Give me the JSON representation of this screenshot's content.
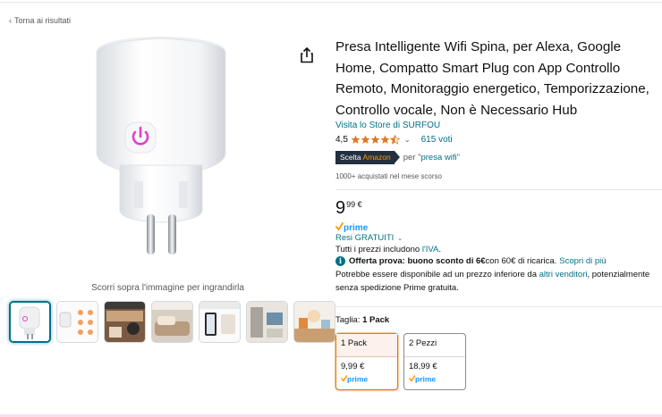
{
  "nav": {
    "back_label": "Torna ai risultati"
  },
  "gallery": {
    "zoom_hint": "Scorri sopra l'immagine per ingrandirla",
    "thumbnails": [
      "thumb-1",
      "thumb-2",
      "thumb-3",
      "thumb-4",
      "thumb-5",
      "thumb-6",
      "thumb-7"
    ]
  },
  "product": {
    "title": "Presa Intelligente Wifi Spina, per Alexa, Google Home, Compatto Smart Plug con App Controllo Remoto, Monitoraggio energetico, Temporizzazione, Controllo vocale, Non è Necessario Hub",
    "store_link": "Visita lo Store di SURFOU",
    "rating_value": "4,5",
    "rating_count": "615 voti",
    "choice_badge_prefix": "Scelta ",
    "choice_badge_brand": "Amazon",
    "choice_for_prefix": "per \"",
    "choice_for_keyword": "presa wifi",
    "choice_for_suffix": "\"",
    "bought_text": "1000+ acquistati nel mese scorso",
    "price_whole": "9",
    "price_fraction": "99 €",
    "prime_label": "prime",
    "returns_label": "Resi GRATUITI",
    "vat_prefix": "Tutti i prezzi includono ",
    "vat_link": "l'IVA",
    "vat_suffix": ".",
    "offer_bold": "Offerta prova: buono sconto di 6€",
    "offer_text": " con 60€ di ricarica.",
    "offer_link": "Scopri di più",
    "other_sellers_prefix": "Potrebbe essere disponibile ad un prezzo inferiore da ",
    "other_sellers_link": "altri venditori",
    "other_sellers_suffix": ", potenzialmente senza spedizione Prime gratuita.",
    "size_label": "Taglia: ",
    "size_selected": "1 Pack",
    "size_options": [
      {
        "name": "1 Pack",
        "price": "9,99 €",
        "prime": "prime"
      },
      {
        "name": "2 Pezzi",
        "price": "18,99 €",
        "prime": "prime"
      }
    ]
  },
  "colors": {
    "link": "#007185",
    "star": "#de7921",
    "power_button": "#e040c8",
    "prime_blue": "#1399ff"
  },
  "icons": {
    "share": "share-icon",
    "info": "info-icon",
    "star": "star-icon",
    "power": "power-icon"
  }
}
